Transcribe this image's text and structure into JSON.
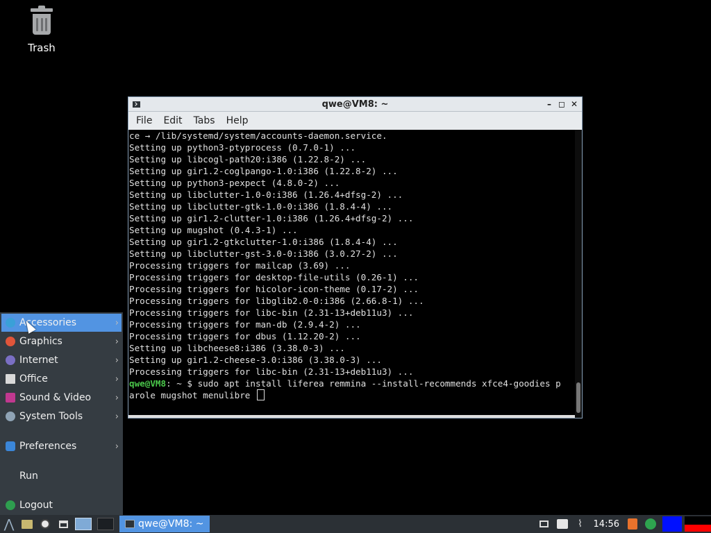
{
  "desktop": {
    "trash_label": "Trash"
  },
  "terminal": {
    "title": "qwe@VM8: ~",
    "menu": [
      "File",
      "Edit",
      "Tabs",
      "Help"
    ],
    "lines": [
      "ce → /lib/systemd/system/accounts-daemon.service.",
      "Setting up python3-ptyprocess (0.7.0-1) ...",
      "Setting up libcogl-path20:i386 (1.22.8-2) ...",
      "Setting up gir1.2-coglpango-1.0:i386 (1.22.8-2) ...",
      "Setting up python3-pexpect (4.8.0-2) ...",
      "Setting up libclutter-1.0-0:i386 (1.26.4+dfsg-2) ...",
      "Setting up libclutter-gtk-1.0-0:i386 (1.8.4-4) ...",
      "Setting up gir1.2-clutter-1.0:i386 (1.26.4+dfsg-2) ...",
      "Setting up mugshot (0.4.3-1) ...",
      "Setting up gir1.2-gtkclutter-1.0:i386 (1.8.4-4) ...",
      "Setting up libclutter-gst-3.0-0:i386 (3.0.27-2) ...",
      "Processing triggers for mailcap (3.69) ...",
      "Processing triggers for desktop-file-utils (0.26-1) ...",
      "Processing triggers for hicolor-icon-theme (0.17-2) ...",
      "Processing triggers for libglib2.0-0:i386 (2.66.8-1) ...",
      "Processing triggers for libc-bin (2.31-13+deb11u3) ...",
      "Processing triggers for man-db (2.9.4-2) ...",
      "Processing triggers for dbus (1.12.20-2) ...",
      "Setting up libcheese8:i386 (3.38.0-3) ...",
      "Setting up gir1.2-cheese-3.0:i386 (3.38.0-3) ...",
      "Processing triggers for libc-bin (2.31-13+deb11u3) ..."
    ],
    "prompt_user": "qwe@VM8",
    "prompt_rest": ": ~ $ ",
    "command_line1": "sudo apt install liferea remmina --install-recommends xfce4-goodies p",
    "command_line2": "arole mugshot menulibre "
  },
  "app_menu": {
    "items": [
      {
        "label": "Accessories",
        "icon": "accessories-icon",
        "color": "#3aa0d8"
      },
      {
        "label": "Graphics",
        "icon": "graphics-icon",
        "color": "#e0553a"
      },
      {
        "label": "Internet",
        "icon": "internet-icon",
        "color": "#7a6fc4"
      },
      {
        "label": "Office",
        "icon": "office-icon",
        "color": "#d9d9d9"
      },
      {
        "label": "Sound & Video",
        "icon": "sound-video-icon",
        "color": "#c0388f"
      },
      {
        "label": "System Tools",
        "icon": "system-tools-icon",
        "color": "#8fa3b5"
      },
      {
        "label": "Preferences",
        "icon": "preferences-icon",
        "color": "#3b86d8"
      },
      {
        "label": "Run",
        "icon": "",
        "color": ""
      },
      {
        "label": "Logout",
        "icon": "logout-icon",
        "color": "#2e9e4f"
      }
    ]
  },
  "taskbar": {
    "task_title": "qwe@VM8: ~",
    "clock": "14:56",
    "accent_active": "#5294e2"
  }
}
